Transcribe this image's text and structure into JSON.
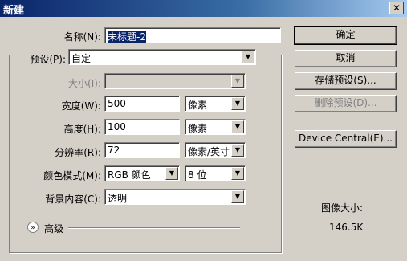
{
  "window": {
    "title": "新建"
  },
  "name": {
    "label": "名称(N):",
    "value": "未标题-2"
  },
  "preset": {
    "label": "预设(P):",
    "value": "自定"
  },
  "size": {
    "label": "大小(I):",
    "value": ""
  },
  "width": {
    "label": "宽度(W):",
    "value": "500",
    "unit": "像素"
  },
  "height": {
    "label": "高度(H):",
    "value": "100",
    "unit": "像素"
  },
  "resolution": {
    "label": "分辨率(R):",
    "value": "72",
    "unit": "像素/英寸"
  },
  "color_mode": {
    "label": "颜色模式(M):",
    "mode": "RGB 颜色",
    "depth": "8 位"
  },
  "background": {
    "label": "背景内容(C):",
    "value": "透明"
  },
  "advanced": {
    "label": "高级"
  },
  "buttons": {
    "ok": "确定",
    "cancel": "取消",
    "save_preset": "存储预设(S)...",
    "delete_preset": "删除预设(D)...",
    "device_central": "Device Central(E)..."
  },
  "image_size": {
    "label": "图像大小:",
    "value": "146.5K"
  },
  "icons": {
    "close": "close-icon",
    "dropdown": "chevron-down-icon",
    "expand": "expand-chevrons-icon"
  }
}
